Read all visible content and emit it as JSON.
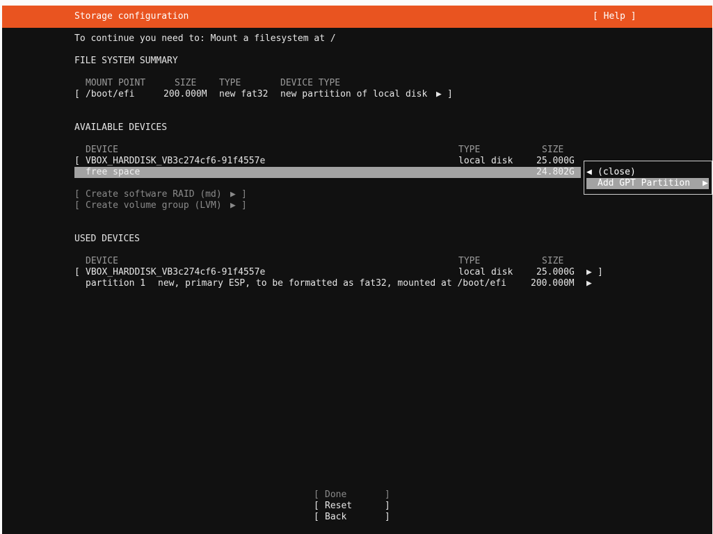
{
  "header": {
    "title": "Storage configuration",
    "help": "[ Help ]"
  },
  "instruction": "To continue you need to: Mount a filesystem at /",
  "fs_summary": {
    "heading": "FILE SYSTEM SUMMARY",
    "columns": [
      "MOUNT POINT",
      "SIZE",
      "TYPE",
      "DEVICE TYPE"
    ],
    "rows": [
      {
        "open": "[",
        "mount": "/boot/efi",
        "size": "200.000M",
        "type": "new fat32",
        "device_type": "new partition of local disk",
        "arrow": "▶",
        "close": "]"
      }
    ]
  },
  "available": {
    "heading": "AVAILABLE DEVICES",
    "columns": [
      "DEVICE",
      "TYPE",
      "SIZE"
    ],
    "disk": {
      "open": "[",
      "name": "VBOX_HARDDISK_VB3c274cf6-91f4557e",
      "type": "local disk",
      "size": "25.000G"
    },
    "free": {
      "label": "free space",
      "size": "24.802G"
    },
    "actions": [
      {
        "open": "[",
        "label": "Create software RAID (md)",
        "arrow": "▶",
        "close": "]"
      },
      {
        "open": "[",
        "label": "Create volume group (LVM)",
        "arrow": "▶",
        "close": "]"
      }
    ]
  },
  "popup": {
    "close_arrow": "◀",
    "close_label": "(close)",
    "add_label": "Add GPT Partition",
    "add_arrow": "▶"
  },
  "used": {
    "heading": "USED DEVICES",
    "columns": [
      "DEVICE",
      "TYPE",
      "SIZE"
    ],
    "disk": {
      "open": "[",
      "name": "VBOX_HARDDISK_VB3c274cf6-91f4557e",
      "type": "local disk",
      "size": "25.000G",
      "arrow": "▶",
      "close": "]"
    },
    "partition": {
      "name": "partition 1",
      "desc": "new, primary ESP, to be formatted as fat32, mounted at /boot/efi",
      "size": "200.000M",
      "arrow": "▶"
    }
  },
  "buttons": {
    "done": {
      "open": "[",
      "label": "Done",
      "close": "]"
    },
    "reset": {
      "open": "[",
      "label": "Reset",
      "close": "]"
    },
    "back": {
      "open": "[",
      "label": "Back",
      "close": "]"
    }
  },
  "colors": {
    "accent": "#e95420",
    "background": "#111111",
    "highlight": "#a3a3a3",
    "text": "#e6e6e6"
  }
}
